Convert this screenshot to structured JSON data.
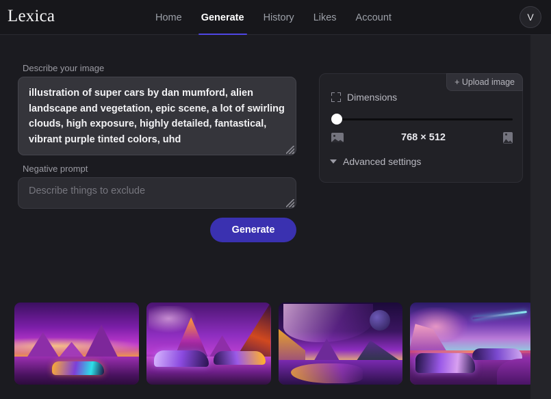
{
  "header": {
    "logo": "Lexica",
    "nav": [
      {
        "label": "Home",
        "active": false
      },
      {
        "label": "Generate",
        "active": true
      },
      {
        "label": "History",
        "active": false
      },
      {
        "label": "Likes",
        "active": false
      },
      {
        "label": "Account",
        "active": false
      }
    ],
    "avatar_initial": "V",
    "accent_color": "#4f46e5"
  },
  "form": {
    "describe_label": "Describe your image",
    "prompt_value": "illustration of super cars by dan mumford, alien landscape and vegetation, epic scene, a lot of swirling clouds, high exposure, highly detailed, fantastical, vibrant purple tinted colors, uhd",
    "prompt_placeholder": "Describe your image",
    "negative_label": "Negative prompt",
    "negative_value": "",
    "negative_placeholder": "Describe things to exclude",
    "generate_label": "Generate",
    "generate_color": "#3a31b0"
  },
  "settings": {
    "upload_label": "+ Upload image",
    "dimensions_label": "Dimensions",
    "size_value": "768 × 512",
    "slider_position_percent": 0,
    "advanced_label": "Advanced settings"
  },
  "results": {
    "count": 4,
    "items": [
      {
        "alt": "purple alien landscape with orange supercar and spires"
      },
      {
        "alt": "two purple supercars on reflective alien plain"
      },
      {
        "alt": "purple mountain valley with swirling clouds and moon"
      },
      {
        "alt": "two supercars on magenta desert with comet streak"
      }
    ]
  }
}
